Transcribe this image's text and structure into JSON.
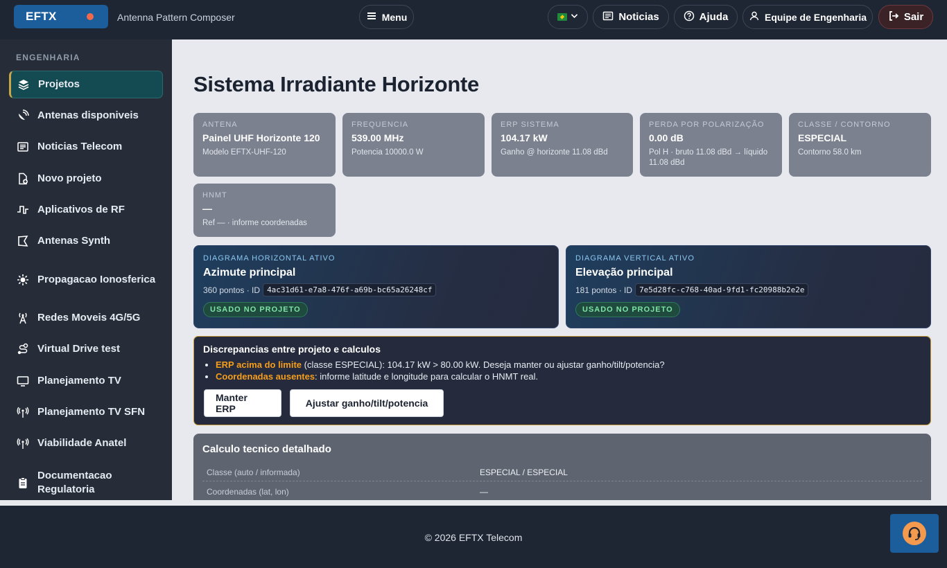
{
  "header": {
    "brand": "EFTX",
    "subtitle": "Antenna Pattern Composer",
    "menu_label": "Menu",
    "news_label": "Noticias",
    "help_label": "Ajuda",
    "team_label": "Equipe de Engenharia",
    "logout_label": "Sair"
  },
  "sidebar": {
    "section": "ENGENHARIA",
    "items": [
      {
        "label": "Projetos",
        "icon": "layers-icon"
      },
      {
        "label": "Antenas disponiveis",
        "icon": "satellite-dish-icon"
      },
      {
        "label": "Noticias Telecom",
        "icon": "newspaper-icon"
      },
      {
        "label": "Novo projeto",
        "icon": "file-plus-icon"
      },
      {
        "label": "Aplicativos de RF",
        "icon": "waveform-icon"
      },
      {
        "label": "Antenas Synth",
        "icon": "synth-icon"
      },
      {
        "label": "Propagacao Ionosferica",
        "icon": "sun-icon"
      },
      {
        "label": "Redes Moveis 4G/5G",
        "icon": "cell-tower-icon"
      },
      {
        "label": "Virtual Drive test",
        "icon": "route-icon"
      },
      {
        "label": "Planejamento TV",
        "icon": "monitor-icon"
      },
      {
        "label": "Planejamento TV SFN",
        "icon": "broadcast-icon"
      },
      {
        "label": "Viabilidade Anatel",
        "icon": "broadcast-icon"
      },
      {
        "label": "Documentacao Regulatoria",
        "icon": "clipboard-icon"
      }
    ]
  },
  "main": {
    "title": "Sistema Irradiante Horizonte",
    "cards": [
      {
        "label": "ANTENA",
        "value": "Painel UHF Horizonte 120",
        "sub": "Modelo EFTX-UHF-120"
      },
      {
        "label": "FREQUENCIA",
        "value": "539.00 MHz",
        "sub": "Potencia 10000.0 W"
      },
      {
        "label": "ERP SISTEMA",
        "value": "104.17 kW",
        "sub": "Ganho @ horizonte 11.08 dBd"
      },
      {
        "label": "PERDA POR POLARIZAÇÃO",
        "value": "0.00 dB",
        "sub": "Pol H · bruto 11.08 dBd → líquido 11.08 dBd"
      },
      {
        "label": "CLASSE / CONTORNO",
        "value": "ESPECIAL",
        "sub": "Contorno 58.0 km"
      },
      {
        "label": "HNMT",
        "value": "—",
        "sub": "Ref — · informe coordenadas"
      }
    ],
    "diagrams": [
      {
        "label": "DIAGRAMA HORIZONTAL ATIVO",
        "title": "Azimute principal",
        "points": "360 pontos · ID",
        "id": "4ac31d61-e7a8-476f-a69b-bc65a26248cf",
        "badge": "USADO NO PROJETO"
      },
      {
        "label": "DIAGRAMA VERTICAL ATIVO",
        "title": "Elevação principal",
        "points": "181 pontos · ID",
        "id": "7e5d28fc-c768-40ad-9fd1-fc20988b2e2e",
        "badge": "USADO NO PROJETO"
      }
    ],
    "alert": {
      "title": "Discrepancias entre projeto e calculos",
      "items": [
        {
          "strong": "ERP acima do limite",
          "text": " (classe ESPECIAL): 104.17 kW > 80.00 kW. Deseja manter ou ajustar ganho/tilt/potencia?"
        },
        {
          "strong": "Coordenadas ausentes",
          "text": ": informe latitude e longitude para calcular o HNMT real."
        }
      ],
      "keep_label": "Manter ERP",
      "adjust_label": "Ajustar ganho/tilt/potencia"
    },
    "calc": {
      "title": "Calculo tecnico detalhado",
      "rows": [
        {
          "key": "Classe (auto / informada)",
          "value": "ESPECIAL / ESPECIAL"
        },
        {
          "key": "Coordenadas (lat, lon)",
          "value": "—"
        }
      ]
    }
  },
  "footer": {
    "copyright": "© 2026 EFTX Telecom"
  },
  "colors": {
    "accent_blue": "#1c5e9c",
    "warning_orange": "#f59e1b",
    "active_teal": "#144a52",
    "success_green": "#7fe3a6"
  }
}
